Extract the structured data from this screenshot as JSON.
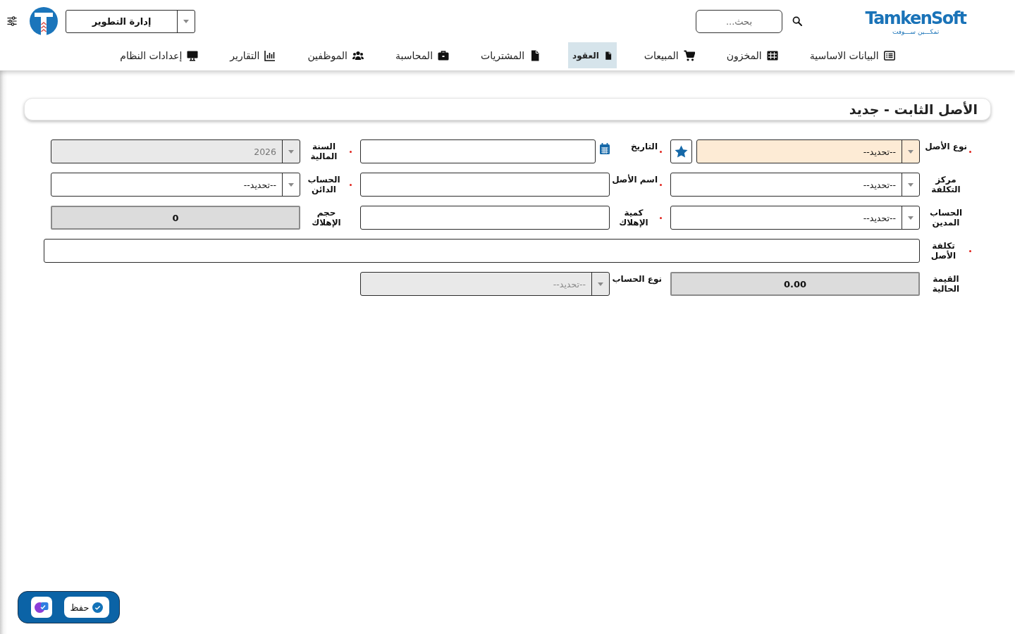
{
  "header": {
    "brand": {
      "name": "TamkenSoft",
      "tagline": "تمكـــين ســـوفت"
    },
    "search": {
      "placeholder": "بحث..."
    },
    "department": {
      "value": "إدارة التطوير"
    }
  },
  "nav": [
    {
      "label": "البيانات الاساسية",
      "selected": false
    },
    {
      "label": "المخزون",
      "selected": false
    },
    {
      "label": "المبيعات",
      "selected": false
    },
    {
      "label": "العقود",
      "selected": true
    },
    {
      "label": "المشتريات",
      "selected": false
    },
    {
      "label": "المحاسبة",
      "selected": false
    },
    {
      "label": "الموظفين",
      "selected": false
    },
    {
      "label": "التقارير",
      "selected": false
    },
    {
      "label": "إعدادات النظام",
      "selected": false
    }
  ],
  "page": {
    "title": "الأصل الثابت - جديد"
  },
  "form": {
    "rows": [
      [
        {
          "label": "نوع الأصل",
          "required": true,
          "kind": "select",
          "value": "--تحديد--",
          "highlighted": true,
          "disabled": false,
          "star_button": true
        },
        {
          "label": "التاريخ",
          "required": true,
          "kind": "date",
          "highlighted": false,
          "disabled": false
        },
        {
          "label": "السنة المالية",
          "required": true,
          "kind": "select",
          "value": "2026",
          "highlighted": false,
          "disabled": true
        }
      ],
      [
        {
          "label": "مركز التكلفة",
          "required": false,
          "kind": "select",
          "value": "--تحديد--",
          "highlighted": false,
          "disabled": false
        },
        {
          "label": "اسم الأصل",
          "required": true,
          "kind": "text",
          "highlighted": false,
          "disabled": false
        },
        {
          "label": "الحساب الدائن",
          "required": true,
          "kind": "select",
          "value": "--تحديد--",
          "highlighted": false,
          "disabled": false
        }
      ],
      [
        {
          "label": "الحساب المدين",
          "required": false,
          "kind": "select",
          "value": "--تحديد--",
          "highlighted": false,
          "disabled": false
        },
        {
          "label": "كمية الإهلاك",
          "required": true,
          "kind": "text",
          "highlighted": false,
          "disabled": false
        },
        {
          "label": "حجم الإهلاك",
          "required": false,
          "kind": "readonly",
          "value": "0",
          "highlighted": false,
          "disabled": false
        }
      ],
      [
        {
          "label": "تكلفة الأصل",
          "required": true,
          "kind": "text",
          "highlighted": false,
          "disabled": false
        }
      ],
      [
        {
          "label": "القيمة الحالية",
          "required": false,
          "kind": "readonly",
          "value": "0.00",
          "highlighted": false,
          "disabled": false
        },
        {
          "label": "نوع الحساب",
          "required": false,
          "kind": "select",
          "placeholder": "--تحديد--",
          "highlighted": false,
          "disabled": true
        }
      ]
    ]
  },
  "toolbar": {
    "save": {
      "label": "حفظ"
    }
  }
}
